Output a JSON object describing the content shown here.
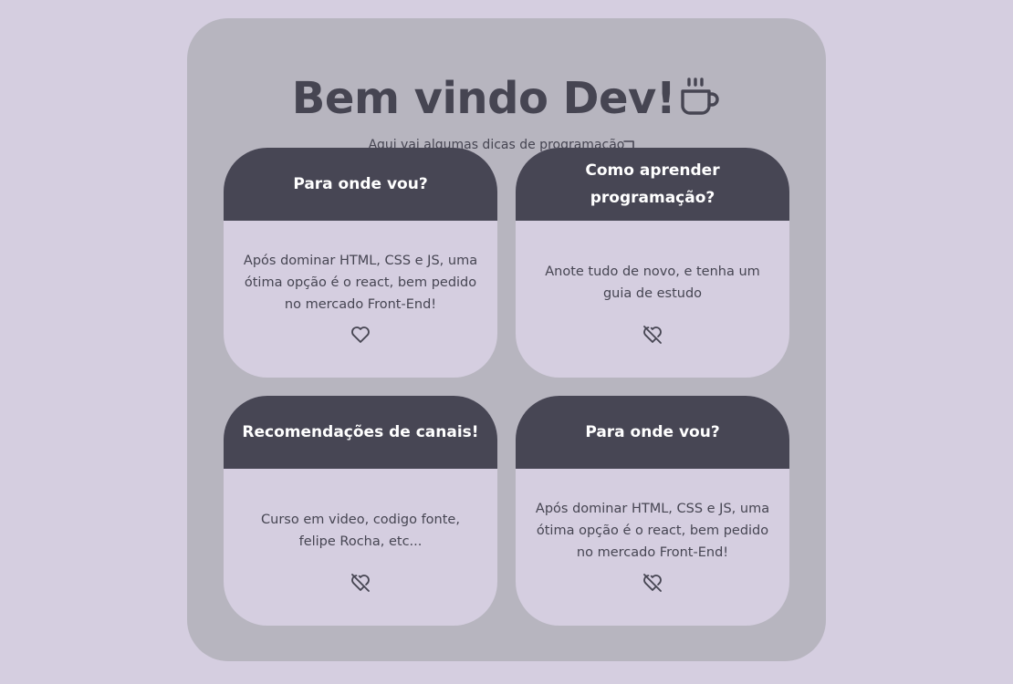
{
  "header": {
    "title": "Bem vindo Dev!",
    "subtitle": "Aqui vai algumas dicas de programação",
    "title_icon": "coffee-icon",
    "subtitle_icon": "arrow-down-right-icon"
  },
  "colors": {
    "background": "#d5cee0",
    "panel": "#b7b5bf",
    "card_header": "#474654",
    "text": "#464552"
  },
  "cards": [
    {
      "title": "Para onde vou?",
      "text": "Após dominar HTML, CSS e JS, uma ótima opção é o react, bem pedido no mercado Front-End!",
      "icon": "heart-icon"
    },
    {
      "title": "Como aprender programação?",
      "text": "Anote tudo de novo, e tenha um guia de estudo",
      "icon": "heart-off-icon"
    },
    {
      "title": "Recomendações de canais!",
      "text": "Curso em video, codigo fonte, felipe Rocha, etc...",
      "icon": "heart-off-icon"
    },
    {
      "title": "Para onde vou?",
      "text": "Após dominar HTML, CSS e JS, uma ótima opção é o react, bem pedido no mercado Front-End!",
      "icon": "heart-off-icon"
    }
  ]
}
